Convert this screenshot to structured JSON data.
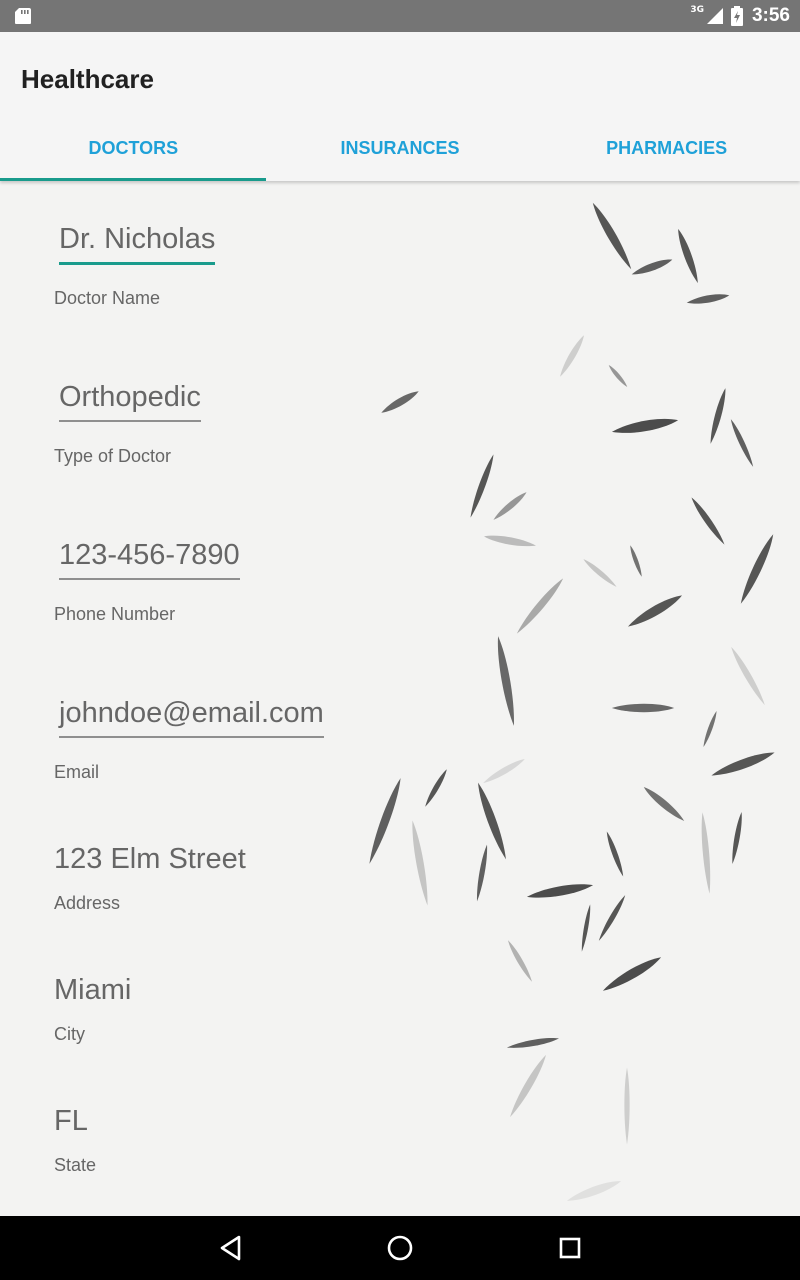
{
  "status_bar": {
    "network_label": "3G",
    "time": "3:56"
  },
  "app_bar": {
    "title": "Healthcare"
  },
  "tabs": [
    {
      "label": "DOCTORS",
      "selected": true
    },
    {
      "label": "INSURANCES",
      "selected": false
    },
    {
      "label": "PHARMACIES",
      "selected": false
    }
  ],
  "form": {
    "doctor_name": {
      "value": "Dr. Nicholas",
      "label": "Doctor Name"
    },
    "doctor_type": {
      "value": "Orthopedic",
      "label": "Type of Doctor"
    },
    "phone": {
      "value": "123-456-7890",
      "label": "Phone Number"
    },
    "email": {
      "value": "johndoe@email.com",
      "label": "Email"
    },
    "address": {
      "value": "123 Elm Street",
      "label": "Address"
    },
    "city": {
      "value": "Miami",
      "label": "City"
    },
    "state": {
      "value": "FL",
      "label": "State"
    }
  },
  "colors": {
    "accent": "#199b8c",
    "tab_text": "#1fa1d8",
    "status_bar": "#757575"
  },
  "icons": {
    "status": [
      "sd-card-icon",
      "signal-icon",
      "battery-icon"
    ],
    "nav": [
      "back-icon",
      "home-icon",
      "recents-icon"
    ]
  }
}
